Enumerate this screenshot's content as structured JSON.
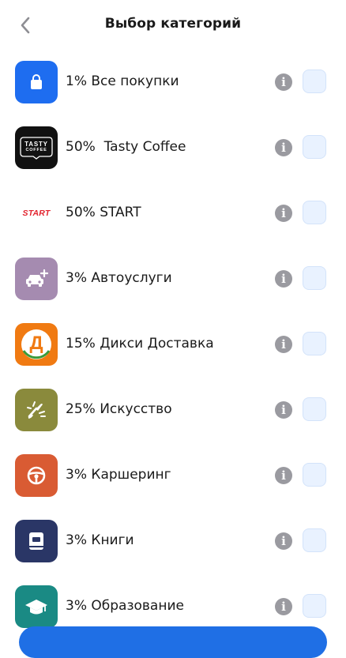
{
  "header": {
    "title": "Выбор категорий",
    "back_icon": "chevron-left-icon"
  },
  "categories": [
    {
      "label": "1% Все покупки",
      "icon": "shopping-bag-icon",
      "icon_bg": "#1e6df0"
    },
    {
      "label": "50%  Tasty Coffee",
      "icon": "tasty-coffee-logo",
      "icon_bg": "#111111",
      "logo_line1": "TASTY",
      "logo_line2": "COFFEE"
    },
    {
      "label": "50% START",
      "icon": "start-logo",
      "icon_bg": "#ffffff",
      "logo_text": "START"
    },
    {
      "label": "3% Автоуслуги",
      "icon": "car-service-icon",
      "icon_bg": "#a58bb0"
    },
    {
      "label": "15% Дикси Доставка",
      "icon": "dixy-logo",
      "icon_bg": "#f07a12",
      "logo_text": "Д"
    },
    {
      "label": "25% Искусство",
      "icon": "art-brush-icon",
      "icon_bg": "#8a8a3c"
    },
    {
      "label": "3% Каршеринг",
      "icon": "steering-wheel-icon",
      "icon_bg": "#d95b33"
    },
    {
      "label": "3% Книги",
      "icon": "book-icon",
      "icon_bg": "#2a3666"
    },
    {
      "label": "3% Образование",
      "icon": "graduation-cap-icon",
      "icon_bg": "#1a8a84"
    }
  ],
  "colors": {
    "accent": "#1f6fe5",
    "info_icon": "#9a9aa0",
    "checkbox_bg": "#e9f2ff"
  }
}
